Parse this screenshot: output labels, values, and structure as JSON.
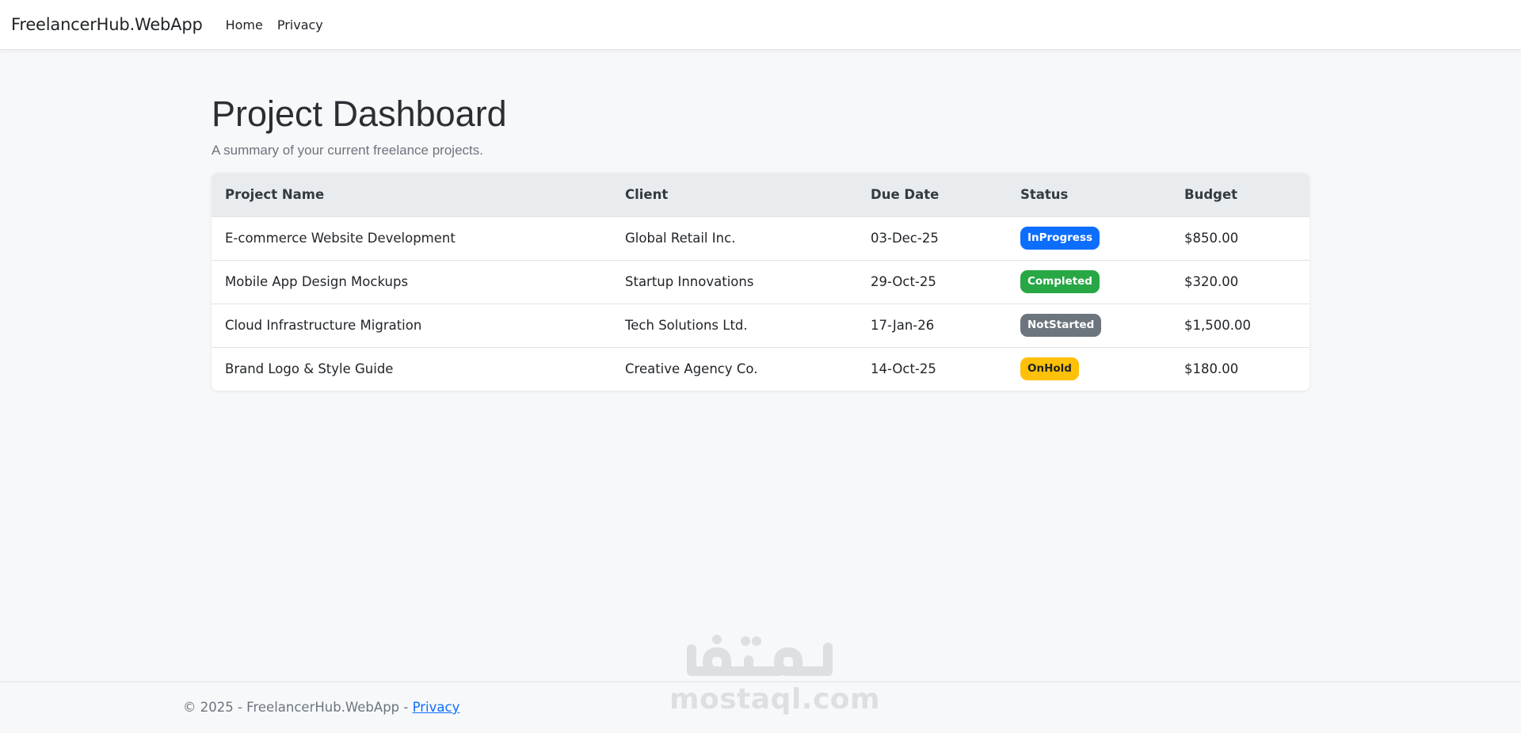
{
  "navbar": {
    "brand": "FreelancerHub.WebApp",
    "links": [
      "Home",
      "Privacy"
    ]
  },
  "main": {
    "title": "Project Dashboard",
    "subtitle": "A summary of your current freelance projects."
  },
  "table": {
    "headers": [
      "Project Name",
      "Client",
      "Due Date",
      "Status",
      "Budget"
    ],
    "rows": [
      {
        "name": "E-commerce Website Development",
        "client": "Global Retail Inc.",
        "due": "03-Dec-25",
        "status": "InProgress",
        "status_color": "#0d6efd",
        "budget": "$850.00"
      },
      {
        "name": "Mobile App Design Mockups",
        "client": "Startup Innovations",
        "due": "29-Oct-25",
        "status": "Completed",
        "status_color": "#28a745",
        "budget": "$320.00"
      },
      {
        "name": "Cloud Infrastructure Migration",
        "client": "Tech Solutions Ltd.",
        "due": "17-Jan-26",
        "status": "NotStarted",
        "status_color": "#6c757d",
        "budget": "$1,500.00"
      },
      {
        "name": "Brand Logo & Style Guide",
        "client": "Creative Agency Co.",
        "due": "14-Oct-25",
        "status": "OnHold",
        "status_color": "#ffc107",
        "budget": "$180.00"
      }
    ]
  },
  "footer": {
    "text": "© 2025 - FreelancerHub.WebApp - ",
    "link": "Privacy"
  },
  "watermark": {
    "arabic": "مستقل",
    "latin": "mostaql.com"
  },
  "colors": {
    "accent": "#0d6efd",
    "header_bg": "#e9ecef",
    "page_bg": "#f7f8fa"
  }
}
